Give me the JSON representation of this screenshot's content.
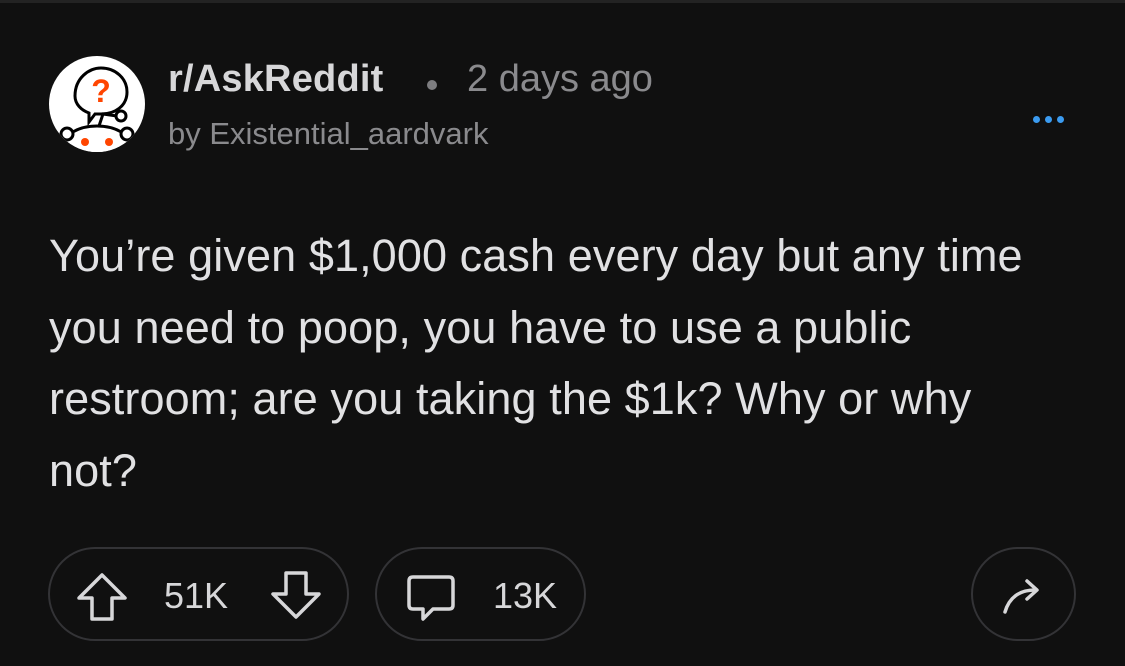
{
  "header": {
    "subreddit": "r/AskReddit",
    "separator": "•",
    "age": "2 days ago",
    "author": "by Existential_aardvark",
    "avatar_icon": "askreddit-snoo-icon",
    "more_icon": "more-horizontal-icon"
  },
  "post": {
    "title": "You’re given $1,000 cash every day but any time you need to poop, you have to use a public restroom; are you taking the $1k? Why or why not?"
  },
  "actions": {
    "upvote_icon": "upvote-arrow-icon",
    "score": "51K",
    "downvote_icon": "downvote-arrow-icon",
    "comment_icon": "comment-bubble-icon",
    "comments": "13K",
    "share_icon": "share-arrow-icon"
  },
  "colors": {
    "background": "#101010",
    "accent_blue": "#3b9bf0",
    "snoo_question_orange": "#ff4500",
    "text_primary": "#e1e1e3",
    "text_secondary": "#8a8a8d"
  }
}
